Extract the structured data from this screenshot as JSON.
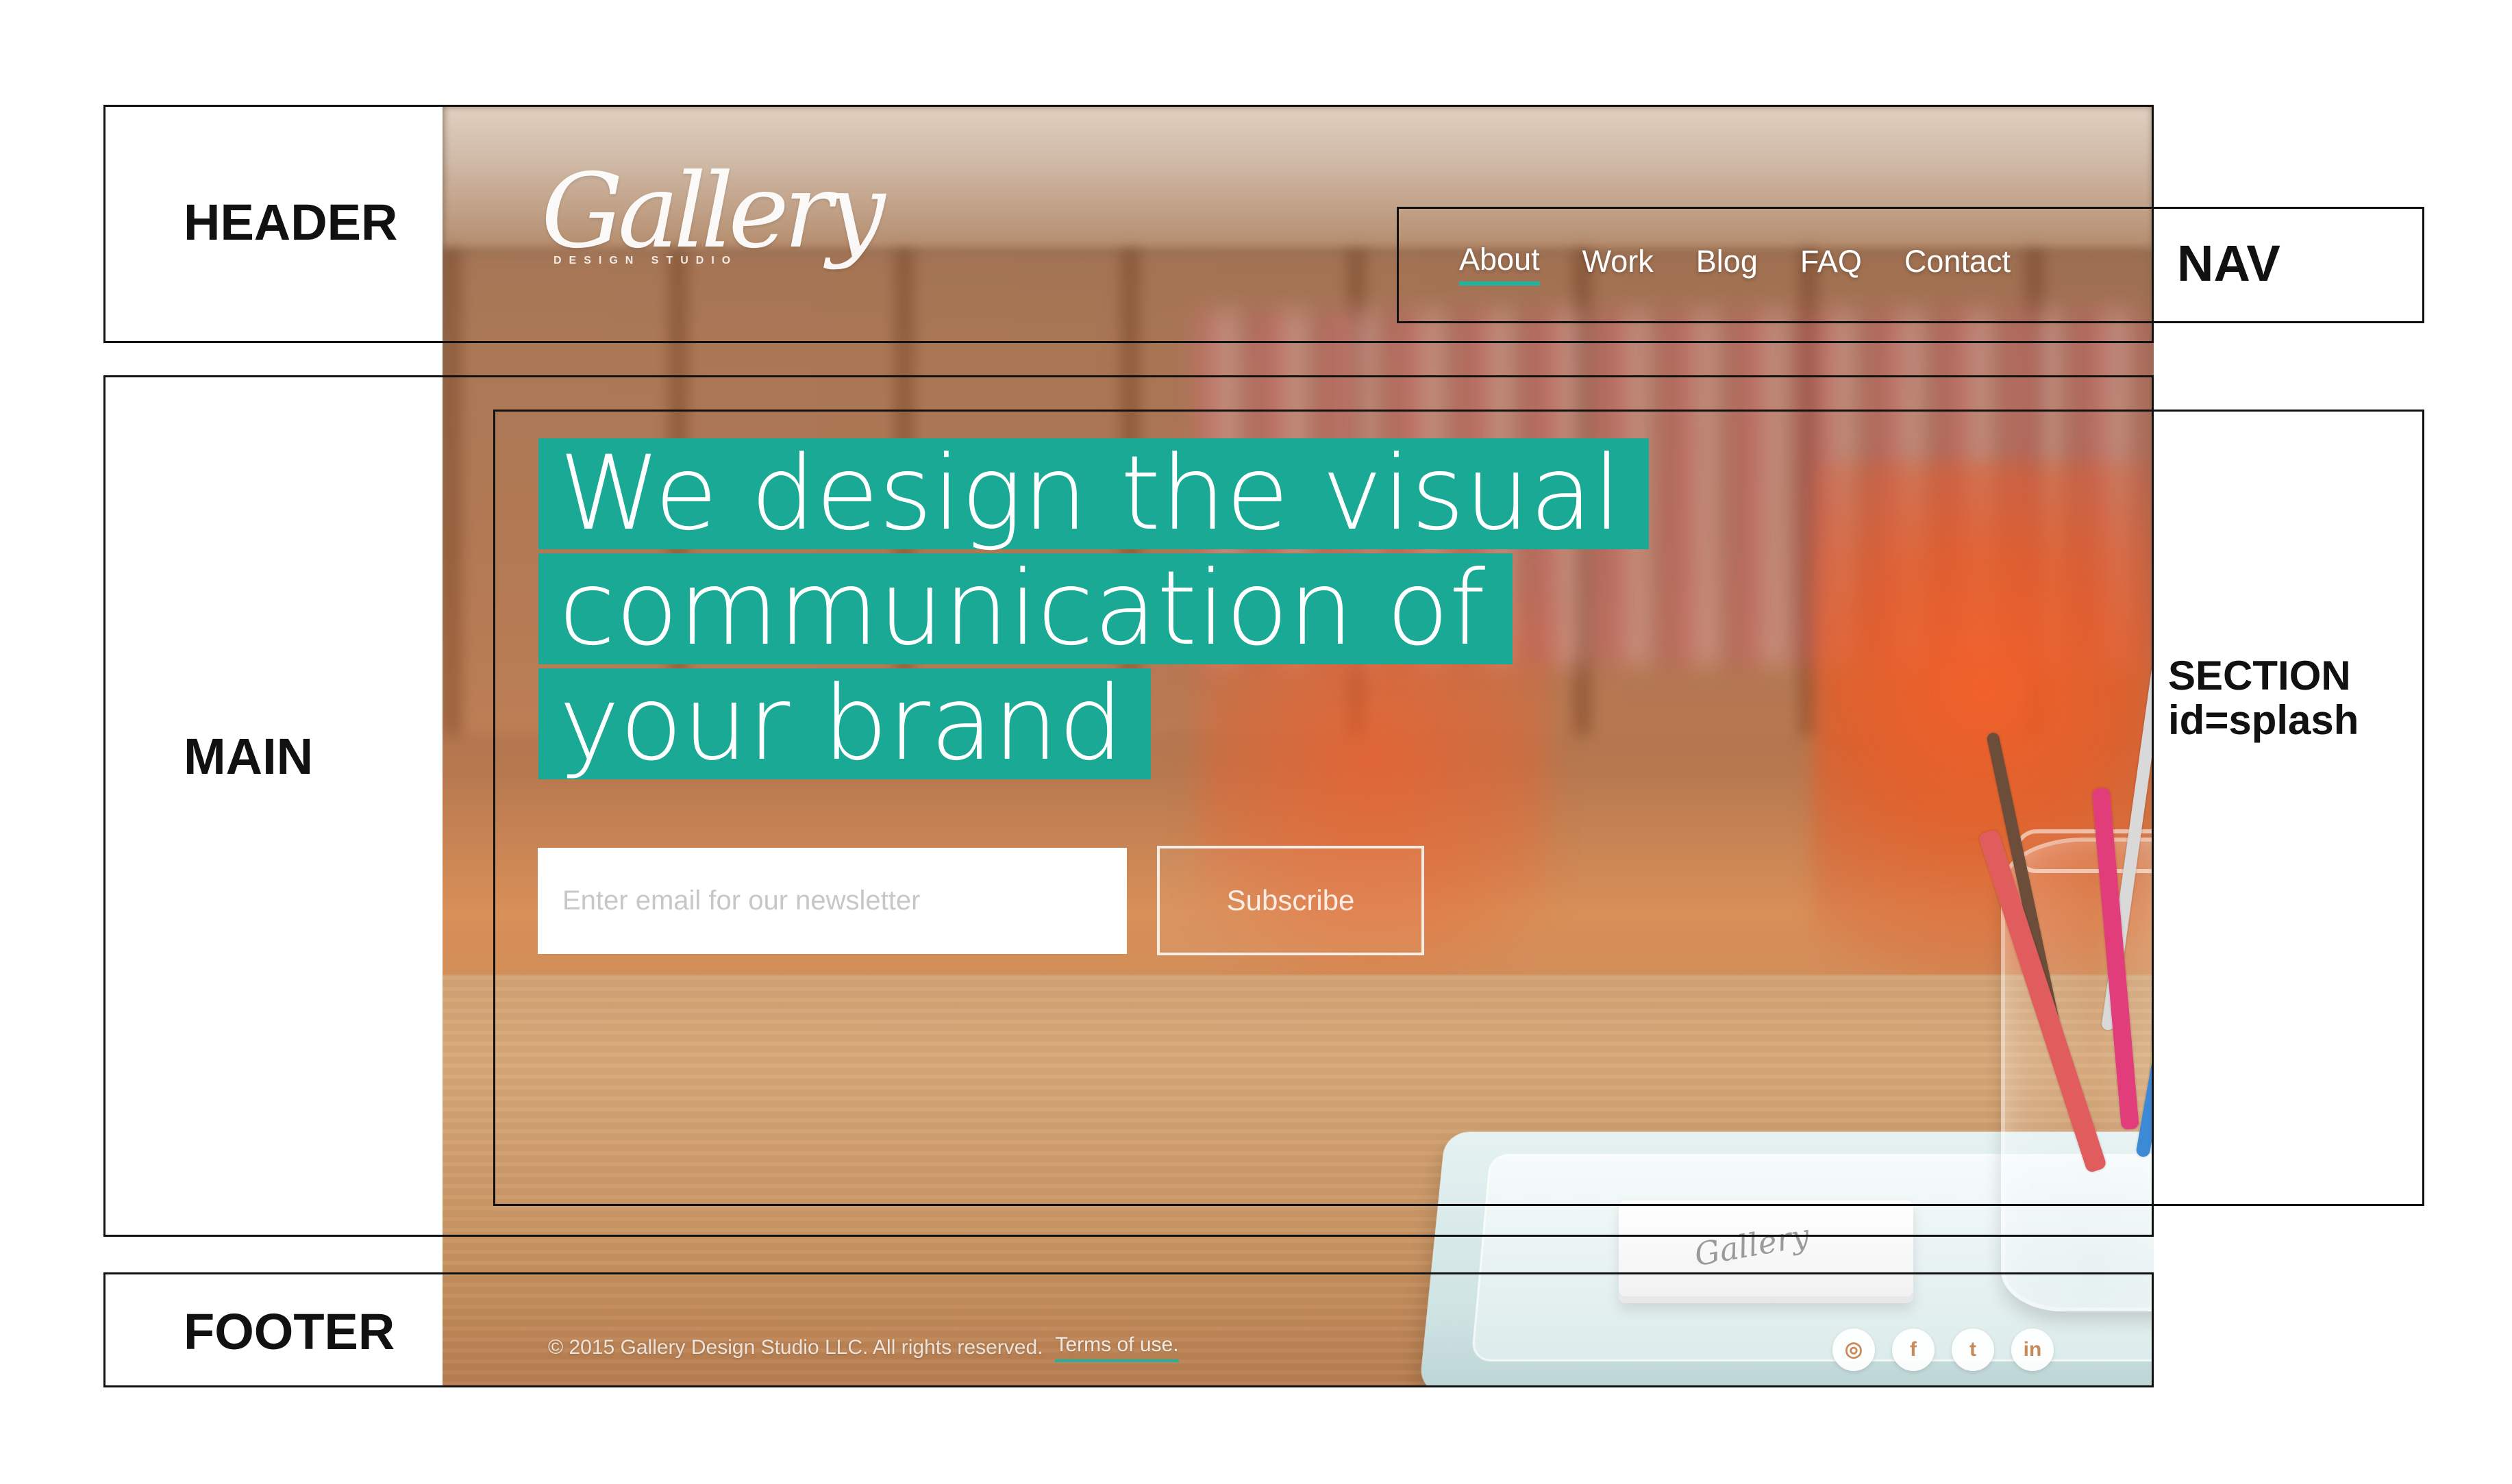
{
  "annotations": {
    "header": "HEADER",
    "nav": "NAV",
    "main": "MAIN",
    "section": "SECTION\nid=splash",
    "footer": "FOOTER"
  },
  "site": {
    "brand": {
      "script": "Gallery",
      "subtitle": "DESIGN STUDIO"
    },
    "nav": {
      "items": [
        {
          "label": "About",
          "active": true
        },
        {
          "label": "Work",
          "active": false
        },
        {
          "label": "Blog",
          "active": false
        },
        {
          "label": "FAQ",
          "active": false
        },
        {
          "label": "Contact",
          "active": false
        }
      ]
    },
    "headline": {
      "line1": "We design the visual",
      "line2": "communication of",
      "line3": "your brand"
    },
    "newsletter": {
      "placeholder": "Enter email for our newsletter",
      "button_label": "Subscribe"
    },
    "footer": {
      "copyright": "© 2015 Gallery Design Studio LLC. All rights reserved.",
      "terms_label": "Terms of use."
    },
    "social": {
      "instagram": "◎",
      "facebook": "f",
      "twitter": "t",
      "linkedin": "in"
    }
  },
  "colors": {
    "accent": "#1aa995",
    "nav_underline": "#1fb3a1",
    "outline": "#111111"
  }
}
